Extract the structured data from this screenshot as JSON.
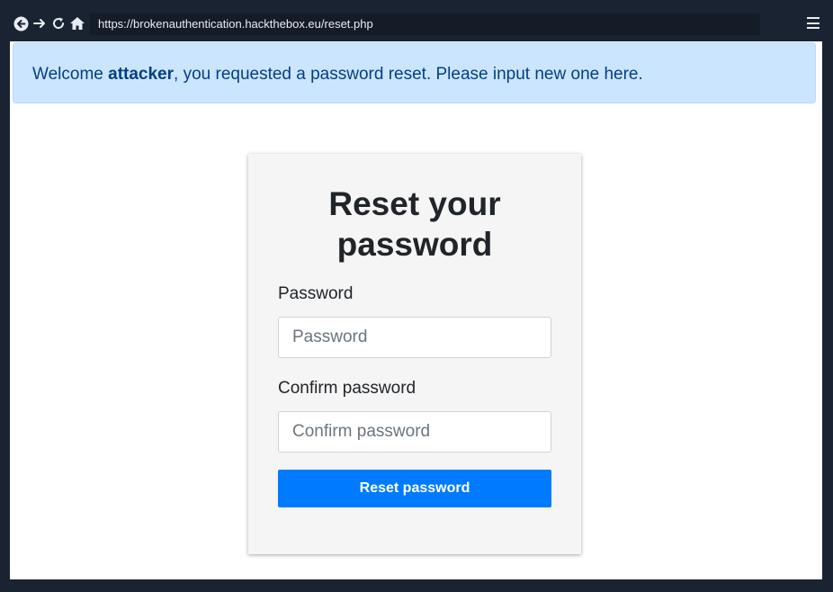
{
  "browser": {
    "url": "https://brokenauthentication.hackthebox.eu/reset.php",
    "nav_icons": [
      "back-icon",
      "forward-icon",
      "reload-icon",
      "home-icon"
    ],
    "menu_icon": "hamburger-menu-icon"
  },
  "alert": {
    "prefix": "Welcome ",
    "username": "attacker",
    "suffix": ", you requested a password reset. Please input new one here."
  },
  "form": {
    "title": "Reset your password",
    "password_label": "Password",
    "password_placeholder": "Password",
    "password_value": "",
    "confirm_label": "Confirm password",
    "confirm_placeholder": "Confirm password",
    "confirm_value": "",
    "submit_label": "Reset password"
  },
  "colors": {
    "browser_chrome": "#1a2332",
    "alert_background": "#cce5ff",
    "alert_text": "#004085",
    "card_background": "#f5f5f5",
    "primary_button": "#007bff"
  }
}
